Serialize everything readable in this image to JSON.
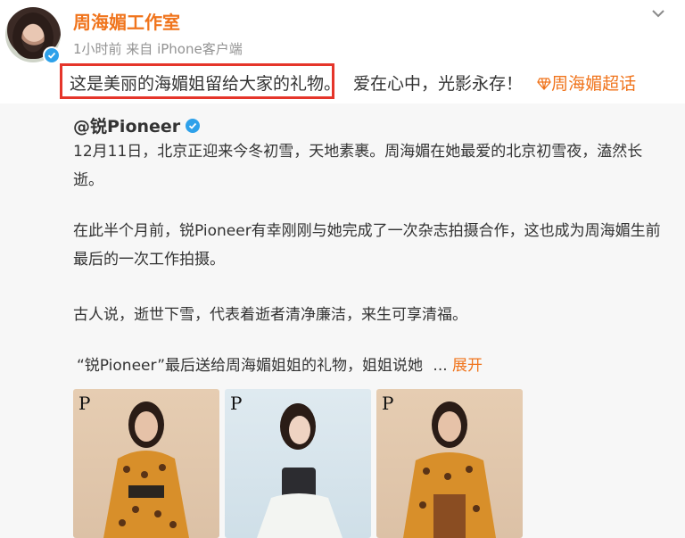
{
  "post": {
    "username": "周海媚工作室",
    "meta": "1小时前 来自 iPhone客户端",
    "highlighted_text": "这是美丽的海媚姐留给大家的礼物。",
    "rest_text": "爱在心中，光影永存！",
    "supertopic_icon": "diamond-icon",
    "supertopic": "周海媚超话",
    "colors": {
      "accent": "#f0741c",
      "highlight_border": "#e5352a",
      "verified": "#2ea1ea"
    }
  },
  "repost": {
    "author": "@锐Pioneer",
    "paragraphs": [
      "12月11日，北京正迎来今冬初雪，天地素裹。周海媚在她最爱的北京初雪夜，溘然长逝。",
      "在此半个月前，锐Pioneer有幸刚刚与她完成了一次杂志拍摄合作，这也成为周海媚生前最后的一次工作拍摄。",
      "古人说，逝世下雪，代表着逝者清净廉洁，来生可享清福。"
    ],
    "last_line": "“锐Pioneer”最后送给周海媚姐姐的礼物，姐姐说她",
    "ellipsis": "...",
    "expand_label": "展开",
    "image_brand": "P"
  }
}
